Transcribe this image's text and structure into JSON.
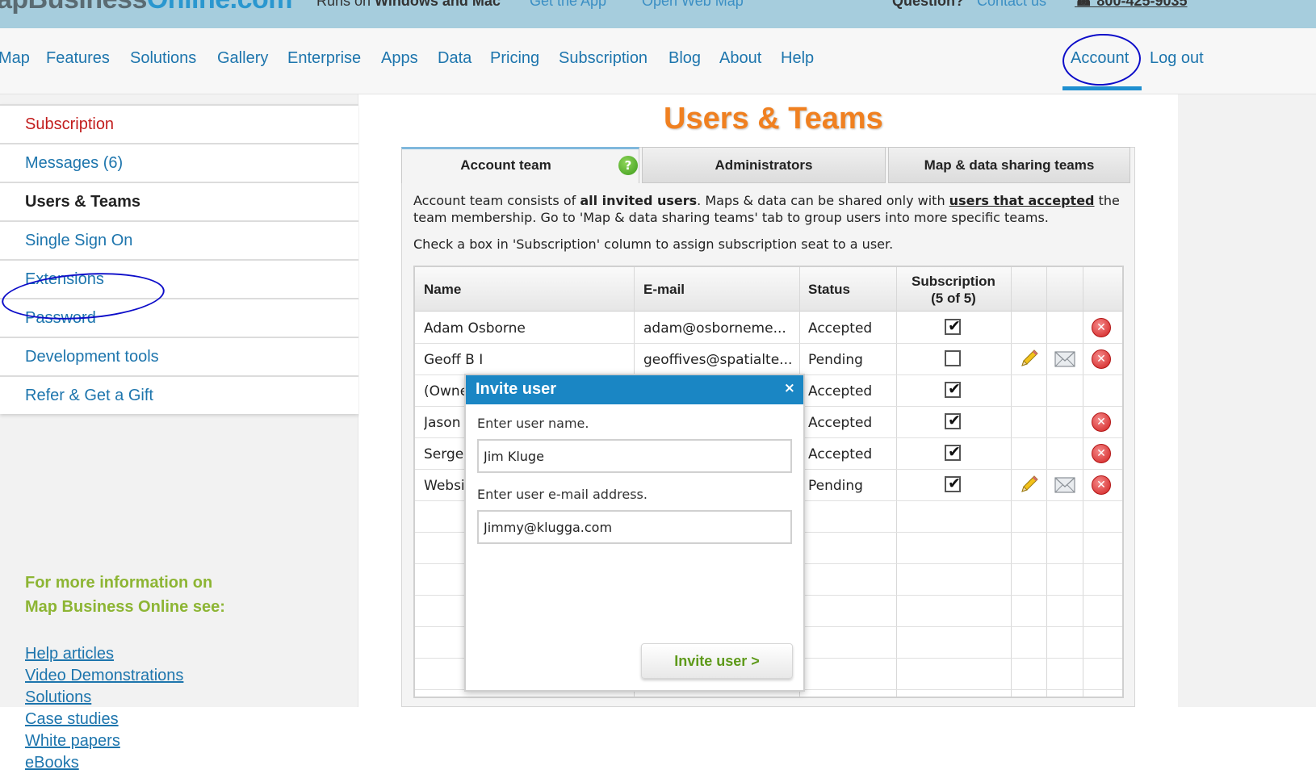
{
  "topbar": {
    "logo_left": "apBusiness",
    "logo_right": "Online.com",
    "runs_on_prefix": "Runs on ",
    "runs_on_bold": "Windows and Mac",
    "get_app": "Get the App",
    "open_web_map": "Open Web Map",
    "question": "Question?",
    "contact": "Contact us",
    "phone": "☎ 800-425-9035"
  },
  "nav": {
    "items": [
      "Map",
      "Features",
      "Solutions",
      "Gallery",
      "Enterprise",
      "Apps",
      "Data",
      "Pricing",
      "Subscription",
      "Blog",
      "About",
      "Help"
    ],
    "account": "Account",
    "logout": "Log out"
  },
  "sidebar": {
    "items": [
      "Subscription",
      "Messages (6)",
      "Users & Teams",
      "Single Sign On",
      "Extensions",
      "Password",
      "Development tools",
      "Refer & Get a Gift"
    ],
    "info_title": "For more information on\nMap Business Online see:",
    "links": [
      "Help articles",
      "Video Demonstrations",
      "Solutions",
      "Case studies",
      "White papers",
      "eBooks"
    ]
  },
  "page": {
    "title": "Users & Teams",
    "tabs": [
      "Account team",
      "Administrators",
      "Map & data sharing teams"
    ],
    "help_glyph": "?",
    "desc_1": "Account team consists of ",
    "desc_bold": "all invited users",
    "desc_2": ". Maps & data can be shared only with ",
    "desc_link": "users that accepted",
    "desc_3": " the team membership. Go to 'Map & data sharing teams' tab to group users into more specific teams.",
    "desc_line2": "Check a box in 'Subscription' column to assign subscription seat to a user."
  },
  "table": {
    "headers": {
      "name": "Name",
      "email": "E-mail",
      "status": "Status",
      "subscription": "Subscription",
      "subscription_count": "(5 of 5)"
    },
    "rows": [
      {
        "name": "Adam Osborne",
        "email": "adam@osborneme...",
        "status": "Accepted",
        "checked": "✔",
        "actions": "delete"
      },
      {
        "name": "Geoff B I",
        "email": "geoffives@spatialte...",
        "status": "Pending",
        "checked": "",
        "actions": "edit-mail-delete"
      },
      {
        "name": "(Owne",
        "email": "",
        "status": "Accepted",
        "checked": "✔",
        "actions": ""
      },
      {
        "name": "Jason",
        "email": "",
        "status": "Accepted",
        "checked": "✔",
        "actions": "delete"
      },
      {
        "name": "Serge",
        "email": "",
        "status": "Accepted",
        "checked": "✔",
        "actions": "delete"
      },
      {
        "name": "Websi",
        "email": "",
        "status": "Pending",
        "checked": "✔",
        "actions": "edit-mail-delete"
      }
    ]
  },
  "modal": {
    "title": "Invite user",
    "close": "×",
    "name_label": "Enter user name.",
    "name_value": "Jim Kluge",
    "email_label": "Enter user e-mail address.",
    "email_value": "Jimmy@klugga.com",
    "submit": "Invite user >"
  },
  "icons": {
    "delete": "delete-icon",
    "edit": "pencil-icon",
    "mail": "envelope-icon",
    "help": "help-icon"
  },
  "colors": {
    "title_orange": "#f08020",
    "link_blue": "#1d75ad",
    "modal_blue": "#1a86c4",
    "info_green": "#8db534",
    "annotation_blue": "#0d0dc9"
  }
}
